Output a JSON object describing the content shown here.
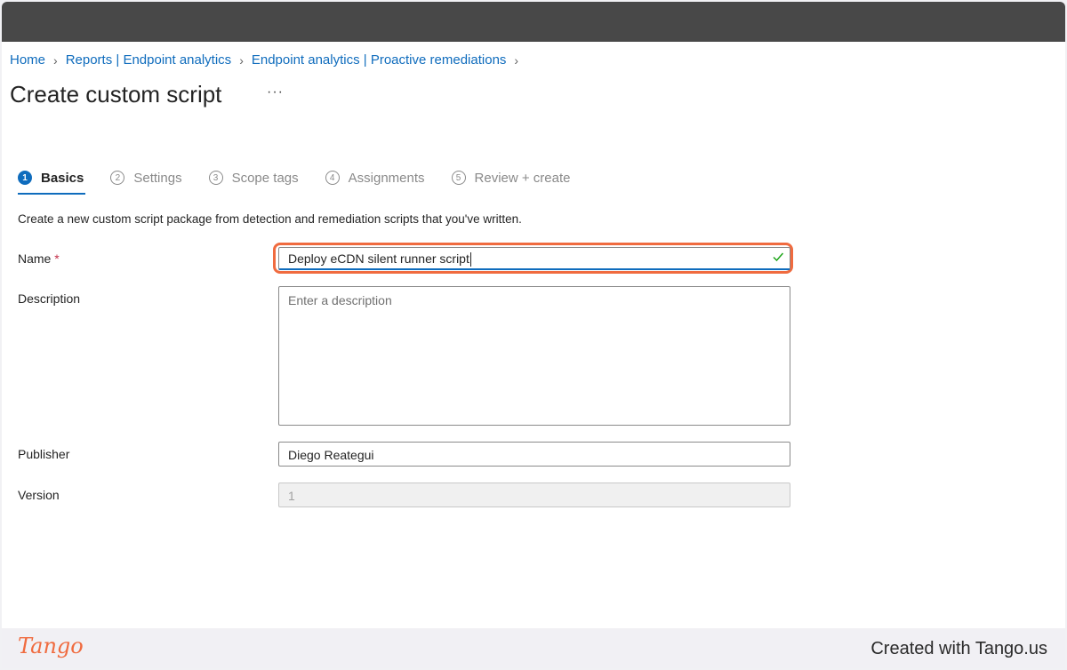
{
  "breadcrumb": {
    "items": [
      "Home",
      "Reports | Endpoint analytics",
      "Endpoint analytics | Proactive remediations"
    ]
  },
  "page": {
    "title": "Create custom script",
    "more_label": "···"
  },
  "steps": [
    {
      "num": "1",
      "label": "Basics",
      "active": true
    },
    {
      "num": "2",
      "label": "Settings",
      "active": false
    },
    {
      "num": "3",
      "label": "Scope tags",
      "active": false
    },
    {
      "num": "4",
      "label": "Assignments",
      "active": false
    },
    {
      "num": "5",
      "label": "Review + create",
      "active": false
    }
  ],
  "form": {
    "intro": "Create a new custom script package from detection and remediation scripts that you've written.",
    "name_label": "Name",
    "required_mark": "*",
    "name_value": "Deploy eCDN silent runner script",
    "description_label": "Description",
    "description_placeholder": "Enter a description",
    "publisher_label": "Publisher",
    "publisher_value": "Diego Reategui",
    "version_label": "Version",
    "version_value": "1"
  },
  "footer": {
    "brand": "Tango",
    "created_text": "Created with Tango.us"
  },
  "colors": {
    "accent": "#0f6cbd",
    "highlight": "#f06b3f",
    "required": "#c4314b",
    "valid_check": "#13a10e"
  },
  "icons": [
    "chevron-right-icon",
    "more-icon",
    "checkmark-icon"
  ]
}
